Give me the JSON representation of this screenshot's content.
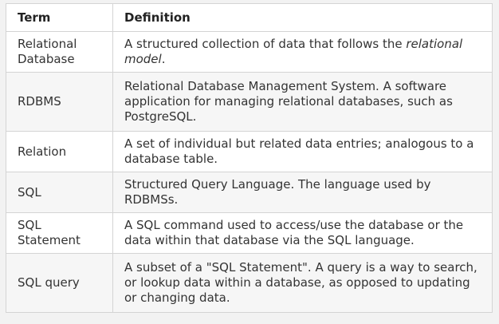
{
  "table": {
    "headers": [
      "Term",
      "Definition"
    ],
    "rows": [
      {
        "term": "Relational Database",
        "def_pre": "A structured collection of data that follows the ",
        "def_em": "relational model",
        "def_post": "."
      },
      {
        "term": "RDBMS",
        "definition": "Relational Database Management System. A software application for managing relational databases, such as PostgreSQL."
      },
      {
        "term": "Relation",
        "definition": "A set of individual but related data entries; analogous to a database table."
      },
      {
        "term": "SQL",
        "definition": "Structured Query Language. The language used by RDBMSs."
      },
      {
        "term": "SQL Statement",
        "definition": "A SQL command used to access/use the database or the data within that database via the SQL language."
      },
      {
        "term": "SQL query",
        "definition": "A subset of a \"SQL Statement\". A query is a way to search, or lookup data within a database, as opposed to updating or changing data."
      }
    ]
  }
}
